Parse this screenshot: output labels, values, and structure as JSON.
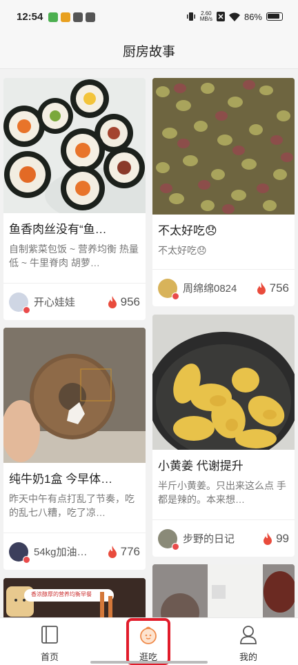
{
  "status": {
    "time": "12:54",
    "speed_top": "2.60",
    "speed_bottom": "MB/s",
    "battery": "86%"
  },
  "header": {
    "title": "厨房故事"
  },
  "cards": [
    {
      "title": "鱼香肉丝没有“鱼…",
      "desc": "自制紫菜包饭 ~ 营养均衡 热量低 ~ 牛里脊肉 胡萝…",
      "user": "开心娃娃",
      "count": "956"
    },
    {
      "title": "不太好吃😞",
      "desc": "不太好吃😞",
      "user": "周绵绵0824",
      "count": "756"
    },
    {
      "title": "纯牛奶1盒 今早体…",
      "desc": "昨天中午有点打乱了节奏，吃的乱七八糟，吃了凉…",
      "user": "54kg加油…",
      "count": "776"
    },
    {
      "title": "小黄姜  代谢提升",
      "desc": "半斤小黄姜。只出来这么点 手都是辣的。本来想…",
      "user": "步野的日记",
      "count": "99"
    }
  ],
  "partial_card_text": "香浓醇厚的营养均衡早餐",
  "tabs": [
    {
      "label": "首页",
      "icon": "home-book-icon"
    },
    {
      "label": "逛吃",
      "icon": "orange-icon"
    },
    {
      "label": "我的",
      "icon": "person-icon"
    }
  ],
  "colors": {
    "accent_red": "#e11b2a",
    "flame": "#e94b3c",
    "background": "#f2f2f2"
  }
}
